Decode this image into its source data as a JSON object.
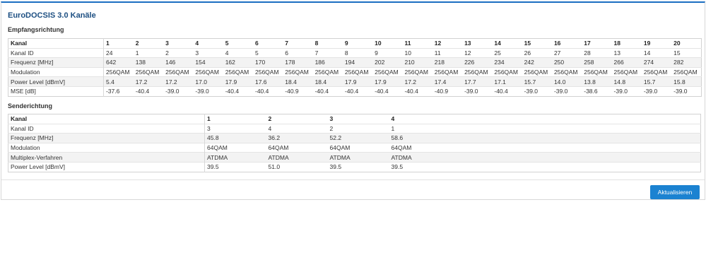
{
  "title": "EuroDOCSIS 3.0 Kanäle",
  "downstream": {
    "section_title": "Empfangsrichtung",
    "header": [
      "Kanal",
      "1",
      "2",
      "3",
      "4",
      "5",
      "6",
      "7",
      "8",
      "9",
      "10",
      "11",
      "12",
      "13",
      "14",
      "15",
      "16",
      "17",
      "18",
      "19",
      "20"
    ],
    "rows": [
      {
        "label": "Kanal ID",
        "values": [
          "24",
          "1",
          "2",
          "3",
          "4",
          "5",
          "6",
          "7",
          "8",
          "9",
          "10",
          "11",
          "12",
          "25",
          "26",
          "27",
          "28",
          "13",
          "14",
          "15"
        ]
      },
      {
        "label": "Frequenz [MHz]",
        "values": [
          "642",
          "138",
          "146",
          "154",
          "162",
          "170",
          "178",
          "186",
          "194",
          "202",
          "210",
          "218",
          "226",
          "234",
          "242",
          "250",
          "258",
          "266",
          "274",
          "282"
        ]
      },
      {
        "label": "Modulation",
        "values": [
          "256QAM",
          "256QAM",
          "256QAM",
          "256QAM",
          "256QAM",
          "256QAM",
          "256QAM",
          "256QAM",
          "256QAM",
          "256QAM",
          "256QAM",
          "256QAM",
          "256QAM",
          "256QAM",
          "256QAM",
          "256QAM",
          "256QAM",
          "256QAM",
          "256QAM",
          "256QAM"
        ]
      },
      {
        "label": "Power Level [dBmV]",
        "values": [
          "5.4",
          "17.2",
          "17.2",
          "17.0",
          "17.9",
          "17.6",
          "18.4",
          "18.4",
          "17.9",
          "17.9",
          "17.2",
          "17.4",
          "17.7",
          "17.1",
          "15.7",
          "14.0",
          "13.8",
          "14.8",
          "15.7",
          "15.8"
        ]
      },
      {
        "label": "MSE [dB]",
        "values": [
          "-37.6",
          "-40.4",
          "-39.0",
          "-39.0",
          "-40.4",
          "-40.4",
          "-40.9",
          "-40.4",
          "-40.4",
          "-40.4",
          "-40.4",
          "-40.9",
          "-39.0",
          "-40.4",
          "-39.0",
          "-39.0",
          "-38.6",
          "-39.0",
          "-39.0",
          "-39.0"
        ]
      }
    ]
  },
  "upstream": {
    "section_title": "Senderichtung",
    "header": [
      "Kanal",
      "1",
      "2",
      "3",
      "4"
    ],
    "rows": [
      {
        "label": "Kanal ID",
        "values": [
          "3",
          "4",
          "2",
          "1"
        ]
      },
      {
        "label": "Frequenz [MHz]",
        "values": [
          "45.8",
          "36.2",
          "52.2",
          "58.6"
        ]
      },
      {
        "label": "Modulation",
        "values": [
          "64QAM",
          "64QAM",
          "64QAM",
          "64QAM"
        ]
      },
      {
        "label": "Multiplex-Verfahren",
        "values": [
          "ATDMA",
          "ATDMA",
          "ATDMA",
          "ATDMA"
        ]
      },
      {
        "label": "Power Level [dBmV]",
        "values": [
          "39.5",
          "51.0",
          "39.5",
          "39.5"
        ]
      }
    ]
  },
  "refresh_button": "Aktualisieren",
  "colors": {
    "accent": "#1b82d1",
    "title": "#1d4f82"
  }
}
